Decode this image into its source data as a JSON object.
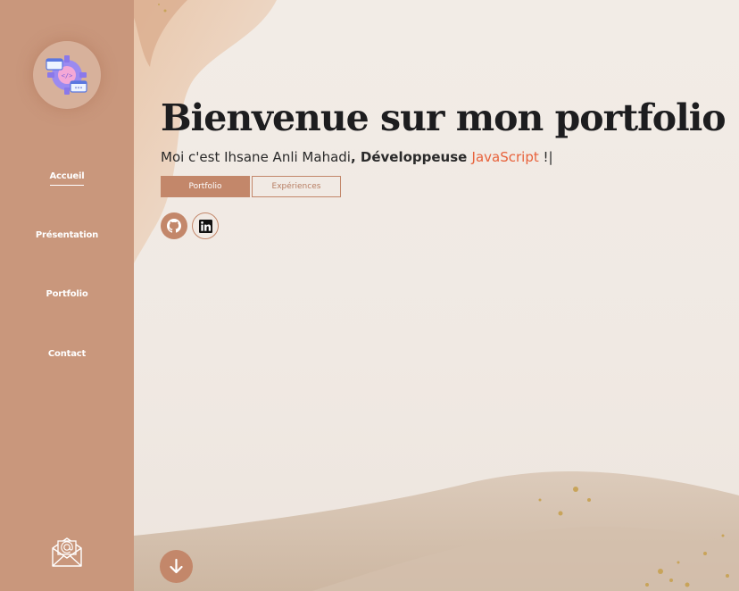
{
  "sidebar": {
    "nav": [
      {
        "label": "Accueil",
        "active": true
      },
      {
        "label": "Présentation",
        "active": false
      },
      {
        "label": "Portfolio",
        "active": false
      },
      {
        "label": "Contact",
        "active": false
      }
    ],
    "logo_icon": "gear-code-icon",
    "mail_icon": "envelope-at-icon"
  },
  "hero": {
    "title": "Bienvenue sur mon portfolio",
    "intro": "Moi c'est Ihsane Anli Mahadi",
    "role": ", Développeuse ",
    "tech": "JavaScript",
    "suffix": " !|",
    "buttons": {
      "primary": "Portfolio",
      "secondary": "Expériences"
    },
    "socials": [
      {
        "name": "github-icon"
      },
      {
        "name": "linkedin-icon"
      }
    ],
    "scroll_icon": "arrow-down-icon"
  },
  "colors": {
    "sidebar": "#c9977c",
    "accent": "#c3876a",
    "highlight": "#e8623b",
    "text": "#1d1d1f"
  }
}
